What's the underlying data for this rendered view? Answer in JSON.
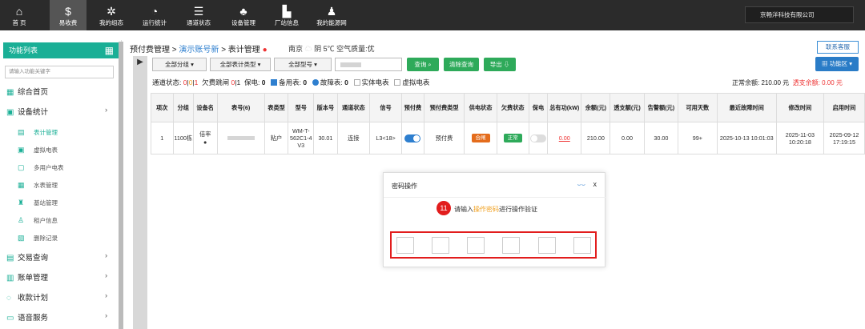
{
  "topnav": {
    "items": [
      {
        "label": "首 页",
        "icon": "home-icon",
        "glyph": "⌂"
      },
      {
        "label": "易收费",
        "icon": "money-bag-icon",
        "glyph": "$",
        "active": true
      },
      {
        "label": "我的组态",
        "icon": "gear-icon",
        "glyph": "✲"
      },
      {
        "label": "运行统计",
        "icon": "pie-chart-icon",
        "glyph": "◔"
      },
      {
        "label": "通道状态",
        "icon": "sliders-icon",
        "glyph": "☰"
      },
      {
        "label": "设备管理",
        "icon": "network-icon",
        "glyph": "♣"
      },
      {
        "label": "厂站信息",
        "icon": "building-icon",
        "glyph": "▙"
      },
      {
        "label": "我的能源网",
        "icon": "user-icon",
        "glyph": "♟"
      }
    ],
    "company": "京畅洋科技有限公司"
  },
  "sidebar": {
    "title": "功能列表",
    "search_placeholder": "请输入功能关键字",
    "menus": [
      {
        "label": "综合首页",
        "icon": "grid-icon",
        "glyph": "▦"
      },
      {
        "label": "设备统计",
        "icon": "device-icon",
        "glyph": "▣"
      },
      {
        "label": "交易查询",
        "icon": "search-doc-icon",
        "glyph": "▤"
      },
      {
        "label": "账单管理",
        "icon": "bill-icon",
        "glyph": "▥"
      },
      {
        "label": "收款计划",
        "icon": "plan-icon",
        "glyph": "◌"
      },
      {
        "label": "语音服务",
        "icon": "chat-icon",
        "glyph": "▭"
      }
    ],
    "submenus": [
      {
        "label": "表计管理",
        "icon": "meter-icon",
        "glyph": "▤",
        "active": true
      },
      {
        "label": "虚拟电表",
        "icon": "virtual-meter-icon",
        "glyph": "▣"
      },
      {
        "label": "多用户电表",
        "icon": "multi-meter-icon",
        "glyph": "▢"
      },
      {
        "label": "水表管理",
        "icon": "water-meter-icon",
        "glyph": "▦"
      },
      {
        "label": "基站管理",
        "icon": "station-icon",
        "glyph": "♜"
      },
      {
        "label": "租户信息",
        "icon": "tenant-icon",
        "glyph": "♙"
      },
      {
        "label": "删除记录",
        "icon": "delete-record-icon",
        "glyph": "▧"
      }
    ]
  },
  "breadcrumb": {
    "part1": "预付费管理 >",
    "part2": "演示账号新",
    "part3": "> 表计管理",
    "city": "南京",
    "weather": "阴 5℃ 空气质量:优"
  },
  "toolbar": {
    "contact": "联系客服",
    "group": "全部分组 ▾",
    "meter_type": "全部表计类型 ▾",
    "model": "全部型号 ▾",
    "query": "查询 ⌕",
    "clear": "清除查询",
    "export": "导出 ⇩",
    "function_area": "▦ 功能区 ▾"
  },
  "status": {
    "channel_label": "通道状态:",
    "c0": "0",
    "c1": "0",
    "c2": "1",
    "owe_label": "欠费跳闸",
    "owe0": "0",
    "owe1": "1",
    "keep_label": "保电:",
    "keep": "0",
    "backup_label": "备用表:",
    "backup": "0",
    "fault_label": "故障表:",
    "fault": "0",
    "real_meter": "实体电表",
    "virtual_meter": "虚拟电表",
    "normal_balance_label": "正常余额:",
    "normal_balance": "210.00 元",
    "owe_balance_label": "透支余额:",
    "owe_balance": "0.00 元"
  },
  "table": {
    "headers": [
      "项次",
      "分组",
      "设备名",
      "表号(6)",
      "表类型",
      "型号",
      "版本号",
      "通道状态",
      "信号",
      "预付费",
      "预付费类型",
      "供电状态",
      "欠费状态",
      "保电",
      "总有功(kW)",
      "余额(元)",
      "透支额(元)",
      "告警额(元)",
      "可用天数",
      "最近故障时间",
      "修改时间",
      "启用时间"
    ],
    "row": {
      "index": "1",
      "group": "1100栋",
      "device": "倍率",
      "meter_type": "粘户",
      "model": "WM-T-562C1-4 V3",
      "version": "30.01",
      "channel": "连接",
      "signal": "L3<18>",
      "prepay_type": "预付费",
      "supply": "合闸",
      "owe_state": "正常",
      "total_kw": "0.00",
      "balance": "210.00",
      "overdraft": "0.00",
      "alarm": "30.00",
      "days": "99+",
      "last_fault": "2025-10-13 10:01:03",
      "modified": "2025-11-03 10:20:18",
      "enabled": "2025-09-12 17:19:15"
    }
  },
  "modal": {
    "title": "密码操作",
    "close": "x",
    "eye": "⌣⌣",
    "step": "11",
    "prompt_pre": "请输入",
    "prompt_highlight": "操作密码",
    "prompt_post": "进行操作验证"
  },
  "colors": {
    "accent": "#1aaf96",
    "link": "#2e7fcf",
    "alert": "#e21d1d",
    "green": "#2eaa5a"
  }
}
